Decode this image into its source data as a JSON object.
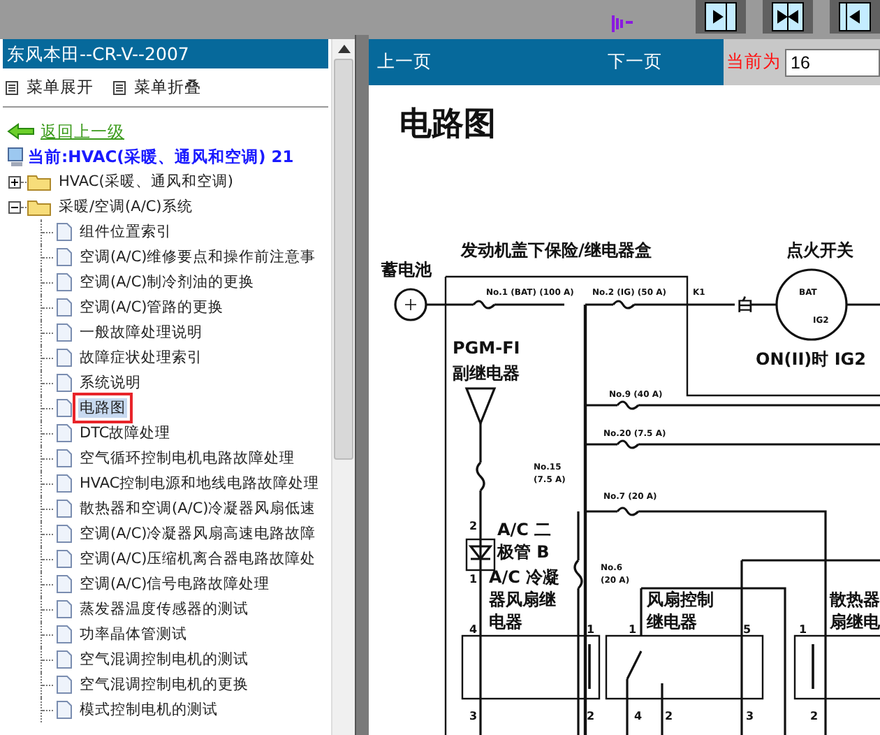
{
  "sidebar": {
    "title": "东风本田--CR-V--2007",
    "menu": [
      {
        "label": "菜单展开"
      },
      {
        "label": "菜单折叠"
      }
    ],
    "back_link": "返回上一级",
    "current": "当前:HVAC(采暖、通风和空调) 21",
    "tree": [
      {
        "label": "HVAC(采暖、通风和空调)",
        "expanded": false
      },
      {
        "label": "采暖/空调(A/C)系统",
        "expanded": true,
        "children": [
          {
            "label": "组件位置索引",
            "selected": false
          },
          {
            "label": "空调(A/C)维修要点和操作前注意事",
            "selected": false
          },
          {
            "label": "空调(A/C)制冷剂油的更换",
            "selected": false
          },
          {
            "label": "空调(A/C)管路的更换",
            "selected": false
          },
          {
            "label": "一般故障处理说明",
            "selected": false
          },
          {
            "label": "故障症状处理索引",
            "selected": false
          },
          {
            "label": "系统说明",
            "selected": false
          },
          {
            "label": "电路图",
            "selected": true
          },
          {
            "label": "DTC故障处理",
            "selected": false
          },
          {
            "label": "空气循环控制电机电路故障处理",
            "selected": false
          },
          {
            "label": "HVAC控制电源和地线电路故障处理",
            "selected": false
          },
          {
            "label": "散热器和空调(A/C)冷凝器风扇低速",
            "selected": false
          },
          {
            "label": "空调(A/C)冷凝器风扇高速电路故障",
            "selected": false
          },
          {
            "label": "空调(A/C)压缩机离合器电路故障处",
            "selected": false
          },
          {
            "label": "空调(A/C)信号电路故障处理",
            "selected": false
          },
          {
            "label": "蒸发器温度传感器的测试",
            "selected": false
          },
          {
            "label": "功率晶体管测试",
            "selected": false
          },
          {
            "label": "空气混调控制电机的测试",
            "selected": false
          },
          {
            "label": "空气混调控制电机的更换",
            "selected": false
          },
          {
            "label": "模式控制电机的测试",
            "selected": false
          }
        ]
      }
    ]
  },
  "viewer": {
    "prev": "上一页",
    "next": "下一页",
    "page_label": "当前为",
    "page_value": "16",
    "document": {
      "title": "电路图",
      "labels": [
        {
          "text": "发动机盖下保险/继电器盒",
          "kind": "heading"
        },
        {
          "text": "点火开关",
          "kind": "heading"
        },
        {
          "text": "蓄电池",
          "kind": "heading"
        },
        {
          "text": "白",
          "kind": "heading"
        },
        {
          "text": "ON(II)时 IG2",
          "kind": "heading"
        },
        {
          "text": "PGM-FI",
          "kind": "heading"
        },
        {
          "text": "副继电器",
          "kind": "heading"
        },
        {
          "text": "No.1 (BAT) (100 A)",
          "kind": "small"
        },
        {
          "text": "No.2 (IG) (50 A)",
          "kind": "small"
        },
        {
          "text": "K1",
          "kind": "small"
        },
        {
          "text": "BAT",
          "kind": "small"
        },
        {
          "text": "IG2",
          "kind": "small"
        },
        {
          "text": "No.9 (40 A)",
          "kind": "small"
        },
        {
          "text": "No.20 (7.5 A)",
          "kind": "small"
        },
        {
          "text": "No.15",
          "kind": "small"
        },
        {
          "text": "(7.5 A)",
          "kind": "small"
        },
        {
          "text": "No.7 (20 A)",
          "kind": "small"
        },
        {
          "text": "No.6",
          "kind": "small"
        },
        {
          "text": "(20 A)",
          "kind": "small"
        },
        {
          "text": "A/C 二",
          "kind": "heading"
        },
        {
          "text": "极管 B",
          "kind": "heading"
        },
        {
          "text": "A/C 冷凝",
          "kind": "heading"
        },
        {
          "text": "器风扇继",
          "kind": "heading"
        },
        {
          "text": "电器",
          "kind": "heading"
        },
        {
          "text": "风扇控制",
          "kind": "heading"
        },
        {
          "text": "继电器",
          "kind": "heading"
        },
        {
          "text": "散热器",
          "kind": "heading"
        },
        {
          "text": "扇继电",
          "kind": "heading"
        },
        {
          "text": "2",
          "kind": "pin"
        },
        {
          "text": "1",
          "kind": "pin"
        },
        {
          "text": "4",
          "kind": "pin"
        },
        {
          "text": "1",
          "kind": "pin"
        },
        {
          "text": "1",
          "kind": "pin"
        },
        {
          "text": "5",
          "kind": "pin"
        },
        {
          "text": "1",
          "kind": "pin"
        },
        {
          "text": "3",
          "kind": "pin"
        },
        {
          "text": "2",
          "kind": "pin"
        },
        {
          "text": "4",
          "kind": "pin"
        },
        {
          "text": "2",
          "kind": "pin"
        },
        {
          "text": "3",
          "kind": "pin"
        },
        {
          "text": "2",
          "kind": "pin"
        }
      ]
    }
  }
}
